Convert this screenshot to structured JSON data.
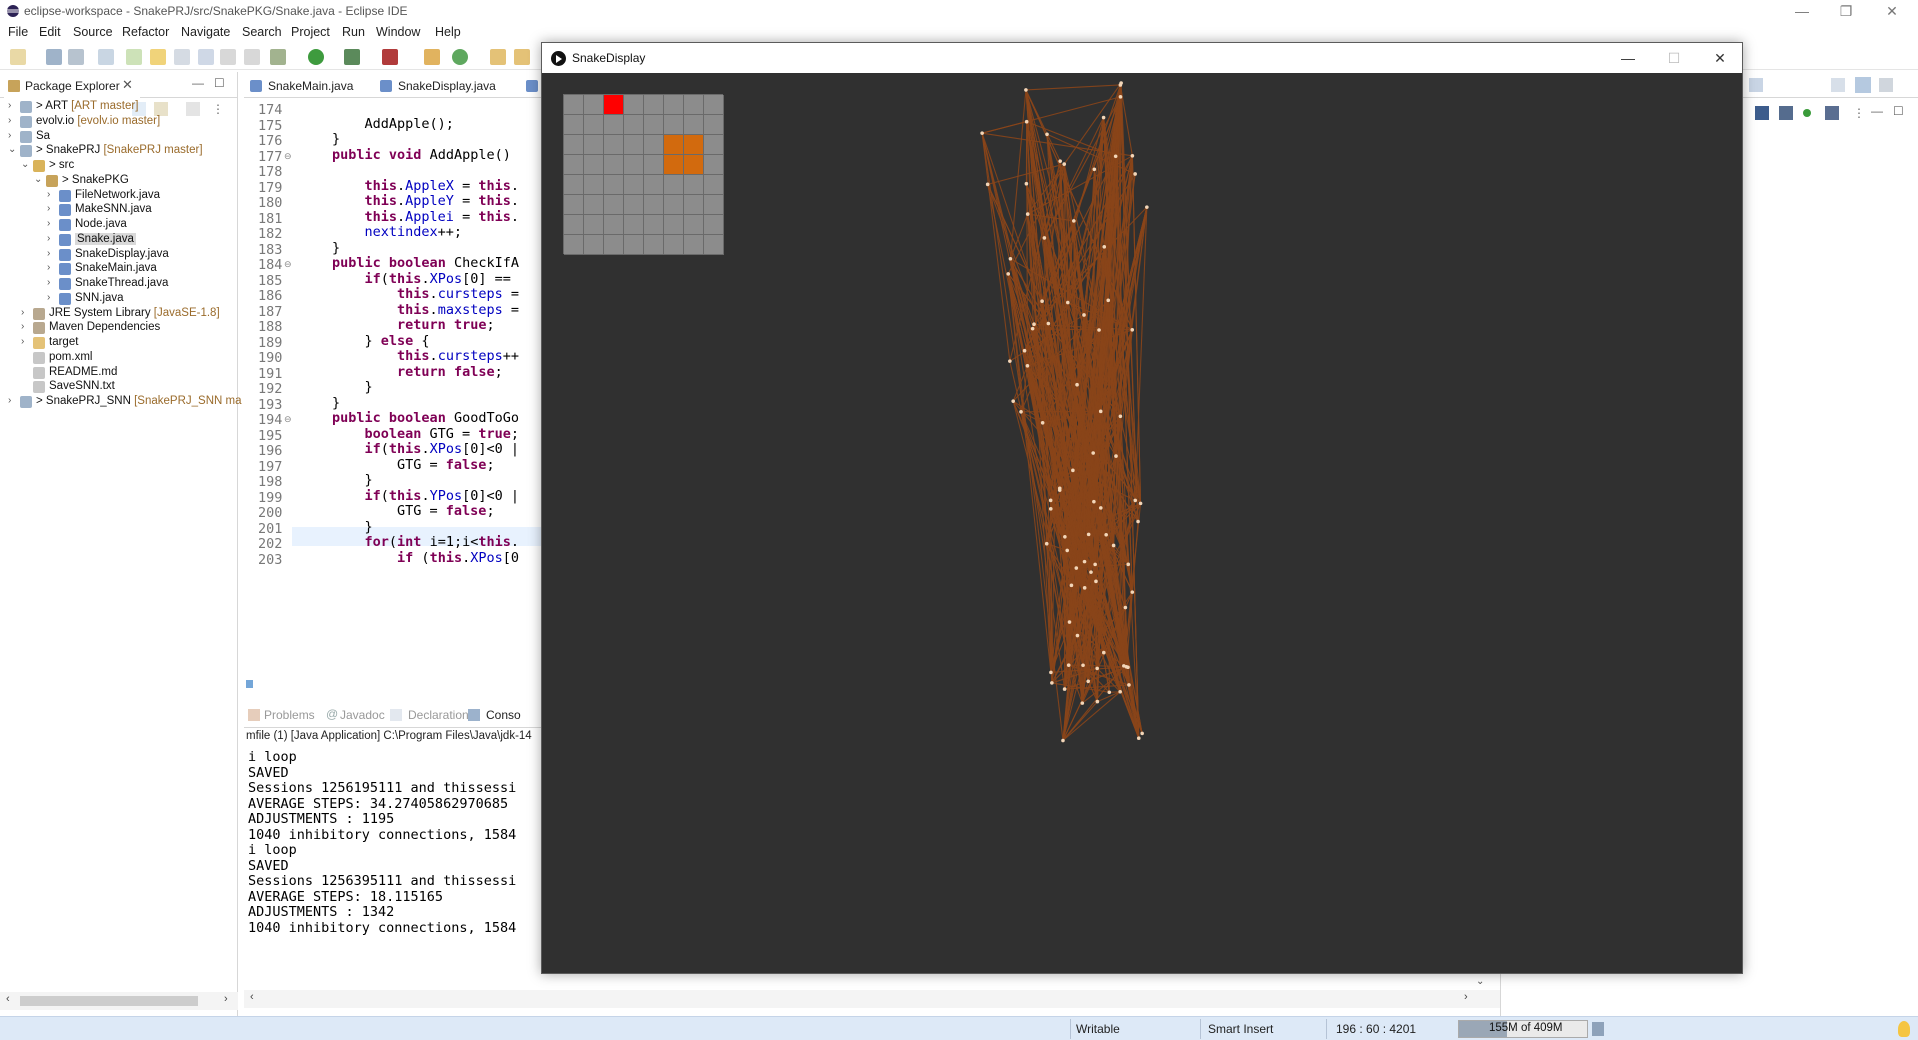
{
  "window": {
    "title": "eclipse-workspace - SnakePRJ/src/SnakePKG/Snake.java - Eclipse IDE",
    "minimize": "—",
    "restore": "❐",
    "close": "✕"
  },
  "menu": [
    "File",
    "Edit",
    "Source",
    "Refactor",
    "Navigate",
    "Search",
    "Project",
    "Run",
    "Window",
    "Help"
  ],
  "package_explorer": {
    "tab_label": "Package Explorer",
    "tab_close": "✕",
    "items": [
      {
        "label": "> ART",
        "decoration": " [ART master]"
      },
      {
        "label": "evolv.io",
        "decoration": " [evolv.io master]"
      },
      {
        "label": "Sa",
        "decoration": ""
      },
      {
        "label": "> SnakePRJ",
        "decoration": " [SnakePRJ master]"
      },
      {
        "label": "> src",
        "decoration": ""
      },
      {
        "label": "> SnakePKG",
        "decoration": ""
      },
      {
        "label": "FileNetwork.java",
        "decoration": ""
      },
      {
        "label": "MakeSNN.java",
        "decoration": ""
      },
      {
        "label": "Node.java",
        "decoration": ""
      },
      {
        "label": "Snake.java",
        "decoration": ""
      },
      {
        "label": "SnakeDisplay.java",
        "decoration": ""
      },
      {
        "label": "SnakeMain.java",
        "decoration": ""
      },
      {
        "label": "SnakeThread.java",
        "decoration": ""
      },
      {
        "label": "SNN.java",
        "decoration": ""
      },
      {
        "label": "JRE System Library",
        "decoration": " [JavaSE-1.8]"
      },
      {
        "label": "Maven Dependencies",
        "decoration": ""
      },
      {
        "label": "target",
        "decoration": ""
      },
      {
        "label": "pom.xml",
        "decoration": ""
      },
      {
        "label": "README.md",
        "decoration": ""
      },
      {
        "label": "SaveSNN.txt",
        "decoration": ""
      },
      {
        "label": "> SnakePRJ_SNN",
        "decoration": " [SnakePRJ_SNN ma"
      }
    ]
  },
  "editor": {
    "tabs": [
      "SnakeMain.java",
      "SnakeDisplay.java"
    ],
    "line_numbers": [
      "174",
      "175",
      "176",
      "177",
      "178",
      "179",
      "180",
      "181",
      "182",
      "183",
      "184",
      "185",
      "186",
      "187",
      "188",
      "189",
      "190",
      "191",
      "192",
      "193",
      "194",
      "195",
      "196",
      "197",
      "198",
      "199",
      "200",
      "201",
      "202",
      "203"
    ],
    "fold_markers": [
      "177",
      "184",
      "194"
    ]
  },
  "bottom_tabs": [
    "Problems",
    "Javadoc",
    "Declaration",
    "Conso"
  ],
  "console": {
    "header": "mfile (1) [Java Application] C:\\Program Files\\Java\\jdk-14",
    "lines": [
      "i loop",
      "SAVED",
      "Sessions 1256195111 and thissessi",
      "AVERAGE STEPS: 34.27405862970685",
      "ADJUSTMENTS : 1195",
      "1040 inhibitory connections, 1584",
      "i loop",
      "SAVED",
      "Sessions 1256395111 and thissessi",
      "AVERAGE STEPS: 18.115165",
      "ADJUSTMENTS : 1342",
      "1040 inhibitory connections, 1584"
    ]
  },
  "status_bar": {
    "writable": "Writable",
    "insert_mode": "Smart Insert",
    "position": "196 : 60 : 4201",
    "heap": "155M of 409M"
  },
  "snake_display": {
    "title": "SnakeDisplay",
    "minimize": "—",
    "maximize": "☐",
    "close": "✕",
    "grid_size": 8,
    "apple": [
      2,
      0
    ],
    "snake": [
      [
        5,
        2
      ],
      [
        6,
        2
      ],
      [
        5,
        3
      ],
      [
        6,
        3
      ]
    ],
    "colors": {
      "background": "#303030",
      "empty_cell": "#8c8c8c",
      "apple": "#ff0000",
      "snake": "#d26a0e",
      "connection": "#8a4519",
      "node": "#f3d6b8"
    }
  }
}
